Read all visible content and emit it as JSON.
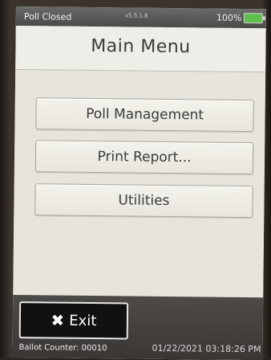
{
  "status_bar": {
    "poll_status": "Poll Closed",
    "version": "v5.5.1.8",
    "battery_percent": "100%"
  },
  "header": {
    "title": "Main Menu"
  },
  "menu": {
    "items": [
      {
        "label": "Poll Management"
      },
      {
        "label": "Print Report..."
      },
      {
        "label": "Utilities"
      }
    ]
  },
  "bottom_bar": {
    "exit_label": "Exit",
    "exit_icon": "close-x-icon"
  },
  "footer": {
    "ballot_counter": "Ballot Counter: 00010",
    "date_time": "01/22/2021 03:18:26 PM"
  },
  "colors": {
    "battery": "#5fc04d",
    "status_bar": "#5a5a58",
    "exit_button": "#111111"
  }
}
